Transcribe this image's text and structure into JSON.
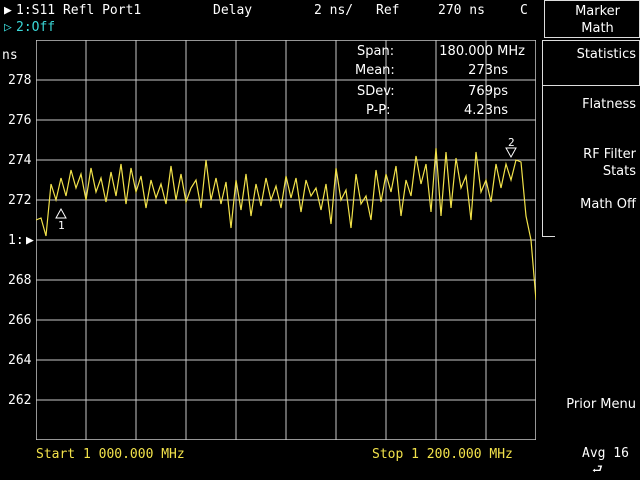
{
  "header": {
    "channel1": "1:S11 Refl Port1",
    "format": "Delay",
    "scale": "2 ns/",
    "ref_label": "Ref",
    "ref_value": "270 ns",
    "coupling": "C",
    "channel2": "2:Off"
  },
  "y_unit": "ns",
  "y_ticks": [
    "278",
    "276",
    "274",
    "272",
    "1:",
    "268",
    "266",
    "264",
    "262"
  ],
  "stats": {
    "span_label": "Span:",
    "span_value": "180.000 MHz",
    "mean_label": "Mean:",
    "mean_value": "273ns",
    "sdev_label": "SDev:",
    "sdev_value": "769ps",
    "pp_label": "P-P:",
    "pp_value": "4.23ns"
  },
  "markers": {
    "m1": "1",
    "m2": "2"
  },
  "footer": {
    "start": "Start 1 000.000 MHz",
    "stop": "Stop 1 200.000 MHz",
    "avg": "Avg 16"
  },
  "softkeys": {
    "title": "Marker\nMath",
    "statistics": "Statistics",
    "flatness": "Flatness",
    "rf_filter": "RF Filter\nStats",
    "math_off": "Math Off",
    "prior_menu": "Prior Menu"
  },
  "chart_data": {
    "type": "line",
    "xlim": [
      1000,
      1200
    ],
    "ylim": [
      260,
      280
    ],
    "grid": true,
    "series": [
      {
        "x": [
          1000,
          1002,
          1004,
          1006,
          1008,
          1010,
          1012,
          1014,
          1016,
          1018,
          1020,
          1022,
          1024,
          1026,
          1028,
          1030,
          1032,
          1034,
          1036,
          1038,
          1040,
          1042,
          1044,
          1046,
          1048,
          1050,
          1052,
          1054,
          1056,
          1058,
          1060,
          1062,
          1064,
          1066,
          1068,
          1070,
          1072,
          1074,
          1076,
          1078,
          1080,
          1082,
          1084,
          1086,
          1088,
          1090,
          1092,
          1094,
          1096,
          1098,
          1100,
          1102,
          1104,
          1106,
          1108,
          1110,
          1112,
          1114,
          1116,
          1118,
          1120,
          1122,
          1124,
          1126,
          1128,
          1130,
          1132,
          1134,
          1136,
          1138,
          1140,
          1142,
          1144,
          1146,
          1148,
          1150,
          1152,
          1154,
          1156,
          1158,
          1160,
          1162,
          1164,
          1166,
          1168,
          1170,
          1172,
          1174,
          1176,
          1178,
          1180,
          1182,
          1184,
          1186,
          1188,
          1190,
          1192,
          1194,
          1196,
          1198,
          1200
        ],
        "y": [
          271.0,
          271.1,
          270.2,
          272.8,
          272.0,
          273.1,
          272.2,
          273.5,
          272.6,
          273.3,
          272.0,
          273.6,
          272.4,
          273.1,
          271.9,
          273.4,
          272.2,
          273.8,
          271.8,
          273.6,
          272.4,
          273.2,
          271.6,
          273.0,
          272.1,
          272.8,
          271.8,
          273.7,
          272.0,
          273.3,
          271.9,
          272.6,
          273.0,
          271.6,
          274.0,
          272.0,
          273.1,
          271.8,
          272.9,
          270.6,
          273.0,
          271.5,
          273.3,
          271.2,
          272.8,
          271.7,
          273.1,
          272.0,
          272.7,
          271.6,
          273.2,
          272.1,
          273.1,
          271.4,
          273.0,
          272.2,
          272.6,
          271.5,
          272.8,
          270.8,
          273.6,
          272.0,
          272.5,
          270.6,
          273.3,
          271.8,
          272.2,
          271.0,
          273.5,
          271.9,
          273.3,
          272.4,
          273.7,
          271.2,
          273.0,
          272.2,
          274.2,
          272.8,
          273.8,
          271.4,
          274.6,
          271.2,
          274.4,
          271.6,
          274.1,
          272.6,
          273.2,
          271.0,
          274.4,
          272.4,
          273.0,
          271.9,
          273.8,
          272.6,
          273.8,
          273.0,
          274.0,
          273.9,
          271.2,
          270.0,
          267.0
        ],
        "marker1": {
          "x": 1010,
          "y": 271.4
        },
        "marker2": {
          "x": 1190,
          "y": 274.0
        }
      }
    ]
  }
}
